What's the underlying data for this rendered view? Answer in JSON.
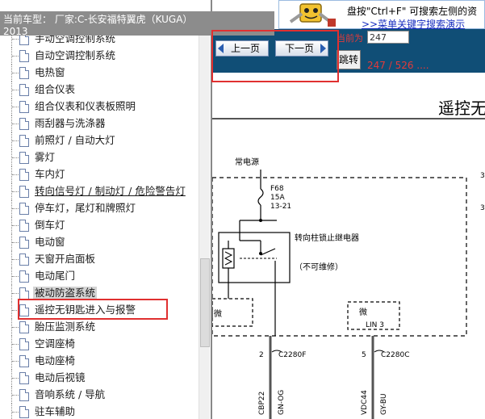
{
  "header": {
    "model_line1": "当前车型： 厂家:C-长安福特翼虎（KUGA）",
    "model_line2": "2013"
  },
  "tree": {
    "items": [
      {
        "label": "手动空调控制系统"
      },
      {
        "label": "自动空调控制系统"
      },
      {
        "label": "电热窗"
      },
      {
        "label": "组合仪表"
      },
      {
        "label": "组合仪表和仪表板照明"
      },
      {
        "label": "雨刮器与洗涤器"
      },
      {
        "label": "前照灯 / 自动大灯"
      },
      {
        "label": "雾灯"
      },
      {
        "label": "车内灯"
      },
      {
        "label": "转向信号灯 / 制动灯 / 危险警告灯"
      },
      {
        "label": "停车灯，尾灯和牌照灯"
      },
      {
        "label": "倒车灯"
      },
      {
        "label": "电动窗"
      },
      {
        "label": "天窗开启面板"
      },
      {
        "label": "电动尾门"
      },
      {
        "label": "被动防盗系统"
      },
      {
        "label": "遥控无钥匙进入与报警"
      },
      {
        "label": "胎压监测系统"
      },
      {
        "label": "空调座椅"
      },
      {
        "label": "电动座椅"
      },
      {
        "label": "电动后视镜"
      },
      {
        "label": "音响系统 / 导航"
      },
      {
        "label": "驻车辅助"
      }
    ]
  },
  "search_tip": {
    "line1": "盘按\"Ctrl+F\" 可搜索左侧的资",
    "line2": ">>菜单关键字搜索演示"
  },
  "toolbar": {
    "prev_label": "上一页",
    "next_label": "下一页",
    "jump_label": "跳转",
    "page_label": "当前为",
    "page_value": "247",
    "page_count": "247 / 526 ...."
  },
  "diagram": {
    "title": "遥控无",
    "power_label": "常电源",
    "fuse_id": "F68",
    "fuse_rating": "15A",
    "fuse_loc": "13-21",
    "relay_label": "转向柱锁止继电器",
    "relay_note": "（不可维修）",
    "left_box_label": "微",
    "right_box_label": "微",
    "right_box_sub": "LIN 3",
    "pin_left": "2",
    "conn_left": "C2280F",
    "pin_right": "5",
    "conn_right": "C2280C",
    "wire_1": "CBP22",
    "wire_2": "GN-OG",
    "wire_3": "VDC44",
    "wire_4": "GY-BU",
    "edge_mark_1": "3",
    "edge_mark_2": "3"
  }
}
